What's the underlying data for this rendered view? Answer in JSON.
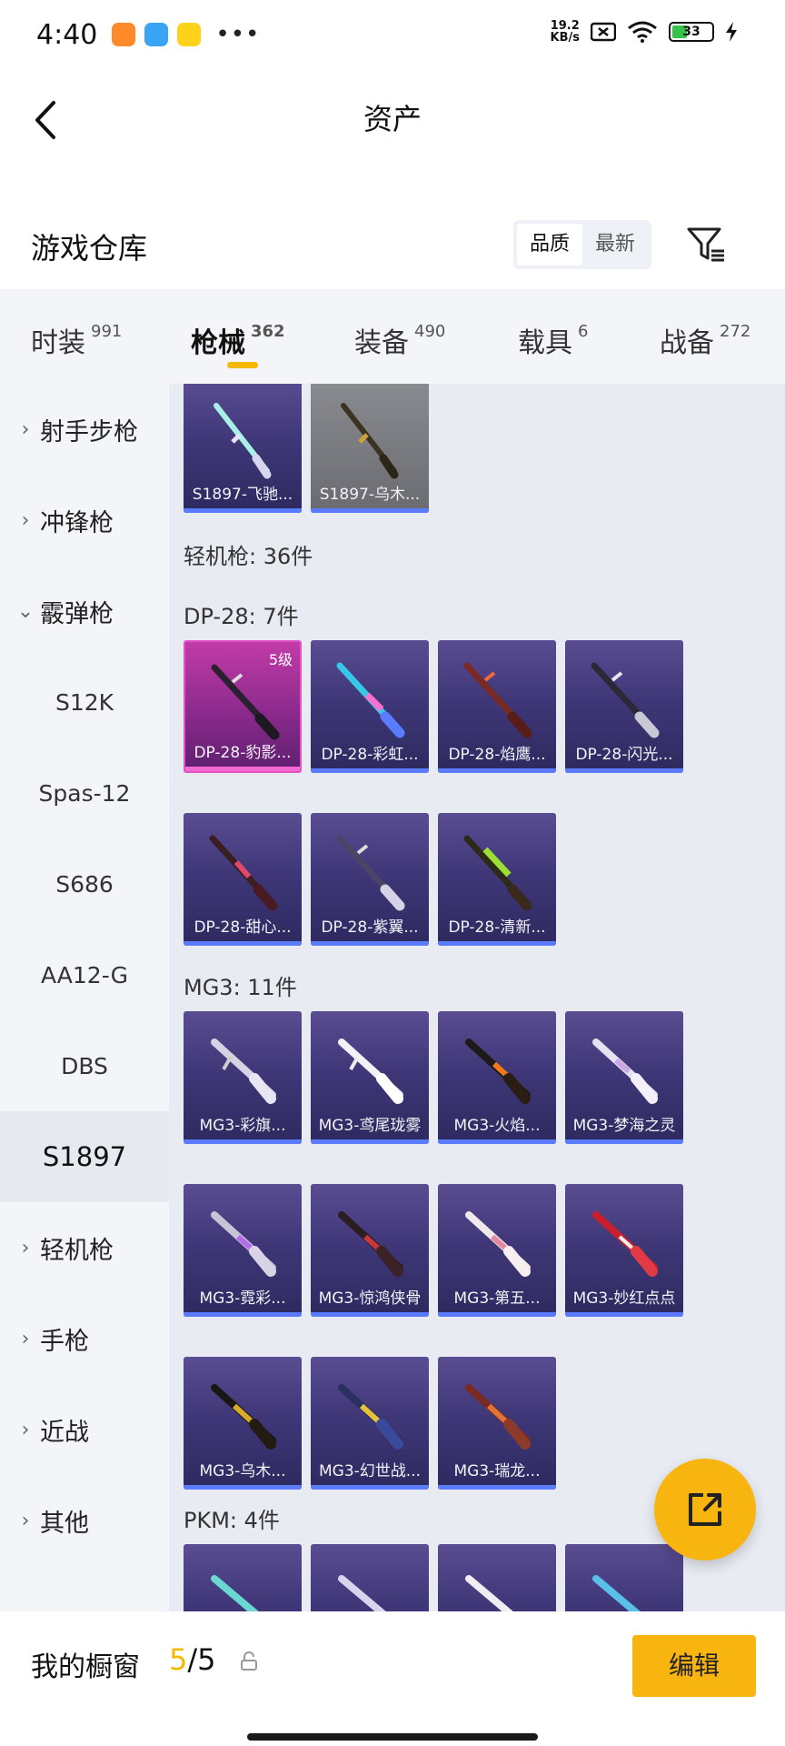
{
  "status_bar": {
    "time": "4:40",
    "net_speed_value": "19.2",
    "net_speed_unit": "KB/s",
    "battery": "33"
  },
  "header": {
    "title": "资产"
  },
  "warehouse": {
    "title": "游戏仓库",
    "sort_options": [
      "品质",
      "最新"
    ]
  },
  "tabs": [
    {
      "label": "时装",
      "count": "991"
    },
    {
      "label": "枪械",
      "count": "362"
    },
    {
      "label": "装备",
      "count": "490"
    },
    {
      "label": "载具",
      "count": "6"
    },
    {
      "label": "战备",
      "count": "272"
    }
  ],
  "sidebar": {
    "items": [
      {
        "label": "射手步枪",
        "chevron": "›"
      },
      {
        "label": "冲锋枪",
        "chevron": "›"
      },
      {
        "label": "霰弹枪",
        "chevron": "⌄"
      },
      {
        "label": "S12K"
      },
      {
        "label": "Spas-12"
      },
      {
        "label": "S686"
      },
      {
        "label": "AA12-G"
      },
      {
        "label": "DBS"
      },
      {
        "label": "S1897"
      },
      {
        "label": "轻机枪",
        "chevron": "›"
      },
      {
        "label": "手枪",
        "chevron": "›"
      },
      {
        "label": "近战",
        "chevron": "›"
      },
      {
        "label": "其他",
        "chevron": "›"
      }
    ]
  },
  "content": {
    "section_lmg": "轻机枪: 36件",
    "section_dp28": "DP-28: 7件",
    "section_mg3": "MG3: 11件",
    "section_pkm": "PKM: 4件",
    "s1897_cards": [
      {
        "name": "S1897-飞驰..."
      },
      {
        "name": "S1897-乌木..."
      }
    ],
    "dp28_cards": [
      {
        "name": "DP-28-豹影...",
        "level": "5级"
      },
      {
        "name": "DP-28-彩虹..."
      },
      {
        "name": "DP-28-焰鹰..."
      },
      {
        "name": "DP-28-闪光..."
      },
      {
        "name": "DP-28-甜心..."
      },
      {
        "name": "DP-28-紫翼..."
      },
      {
        "name": "DP-28-清新..."
      }
    ],
    "mg3_cards": [
      {
        "name": "MG3-彩旗..."
      },
      {
        "name": "MG3-鸢尾珑雾"
      },
      {
        "name": "MG3-火焰..."
      },
      {
        "name": "MG3-梦海之灵"
      },
      {
        "name": "MG3-霓彩..."
      },
      {
        "name": "MG3-惊鸿侠骨"
      },
      {
        "name": "MG3-第五..."
      },
      {
        "name": "MG3-妙红点点"
      },
      {
        "name": "MG3-乌木..."
      },
      {
        "name": "MG3-幻世战..."
      },
      {
        "name": "MG3-瑞龙..."
      }
    ]
  },
  "bottom": {
    "showcase_label": "我的橱窗",
    "showcase_used": "5",
    "showcase_total": "/5",
    "edit_label": "编辑"
  },
  "colors": {
    "accent": "#f8b40f",
    "card_bar": "#5b7bff"
  }
}
